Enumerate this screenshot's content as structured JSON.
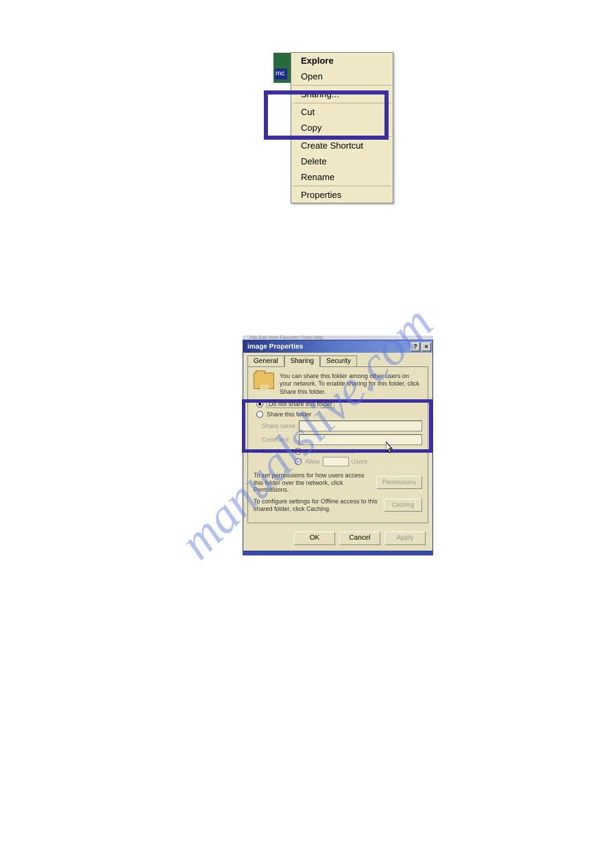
{
  "watermark": "manualslive.com",
  "context_menu": {
    "scrap_text": "mc",
    "items": [
      {
        "label": "Explore",
        "bold": true
      },
      {
        "label": "Open"
      },
      {
        "sep": true
      },
      {
        "label": "Sharing..."
      },
      {
        "sep": true
      },
      {
        "label": "Cut"
      },
      {
        "label": "Copy"
      },
      {
        "sep": true
      },
      {
        "label": "Create Shortcut"
      },
      {
        "label": "Delete"
      },
      {
        "label": "Rename"
      },
      {
        "sep": true
      },
      {
        "label": "Properties"
      }
    ]
  },
  "dialog": {
    "bg_blur": "File  Edit  View  Favorites  Tools  Help",
    "title": "image Properties",
    "help_btn": "?",
    "close_btn": "×",
    "tabs": {
      "general": "General",
      "sharing": "Sharing",
      "security": "Security"
    },
    "info_text": "You can share this folder among other users on your network. To enable sharing for this folder, click Share this folder.",
    "opt_noshare": "Do not share this folder",
    "opt_share": "Share this folder",
    "share_name_label": "Share name:",
    "comment_label": "Comment:",
    "userlimit_label": "User limit:",
    "opt_max": "Maximum allowed",
    "opt_allow": "Allow",
    "users_label": "Users",
    "perm_text": "To set permissions for how users access this folder over the network, click Permissions.",
    "perm_btn": "Permissions",
    "cache_text": "To configure settings for Offline access to this shared folder, click Caching.",
    "cache_btn": "Caching",
    "ok": "OK",
    "cancel": "Cancel",
    "apply": "Apply"
  }
}
